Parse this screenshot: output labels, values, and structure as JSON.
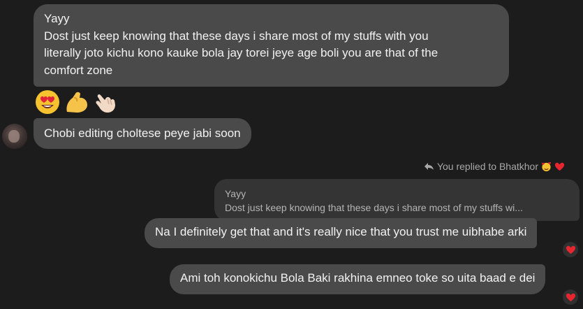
{
  "messages": {
    "msg1": {
      "lines": [
        "Yayy",
        "Dost just keep knowing that these days i share most of my stuffs with you",
        "literally joto kichu kono kauke bola jay torei jeye age boli you are that of the",
        "comfort zone"
      ]
    },
    "emojis": [
      "heart-eyes-face-icon",
      "flexed-biceps-icon",
      "call-me-hand-icon"
    ],
    "msg2": {
      "text": "Chobi editing choltese peye jabi soon"
    },
    "reply_meta": {
      "text": "You replied to Bhatkhor",
      "emojis": [
        "smiling-face-with-hearts-icon",
        "red-heart-icon"
      ]
    },
    "quoted": {
      "lines": [
        "Yayy",
        "Dost just keep knowing that these days i share most of my stuffs wi..."
      ]
    },
    "msg3": {
      "text": "Na I definitely get that and it's really nice that you trust me uibhabe arki",
      "reaction": "red-heart-icon"
    },
    "msg4": {
      "text": "Ami toh konokichu Bola Baki rakhina emneo toke so uita baad e dei",
      "reaction": "red-heart-icon"
    }
  },
  "colors": {
    "background": "#1c1c1d",
    "bubble": "#4a4a4b",
    "quoted_bubble": "#343435",
    "meta_text": "#a8a8a8",
    "heart": "#e8262f"
  }
}
